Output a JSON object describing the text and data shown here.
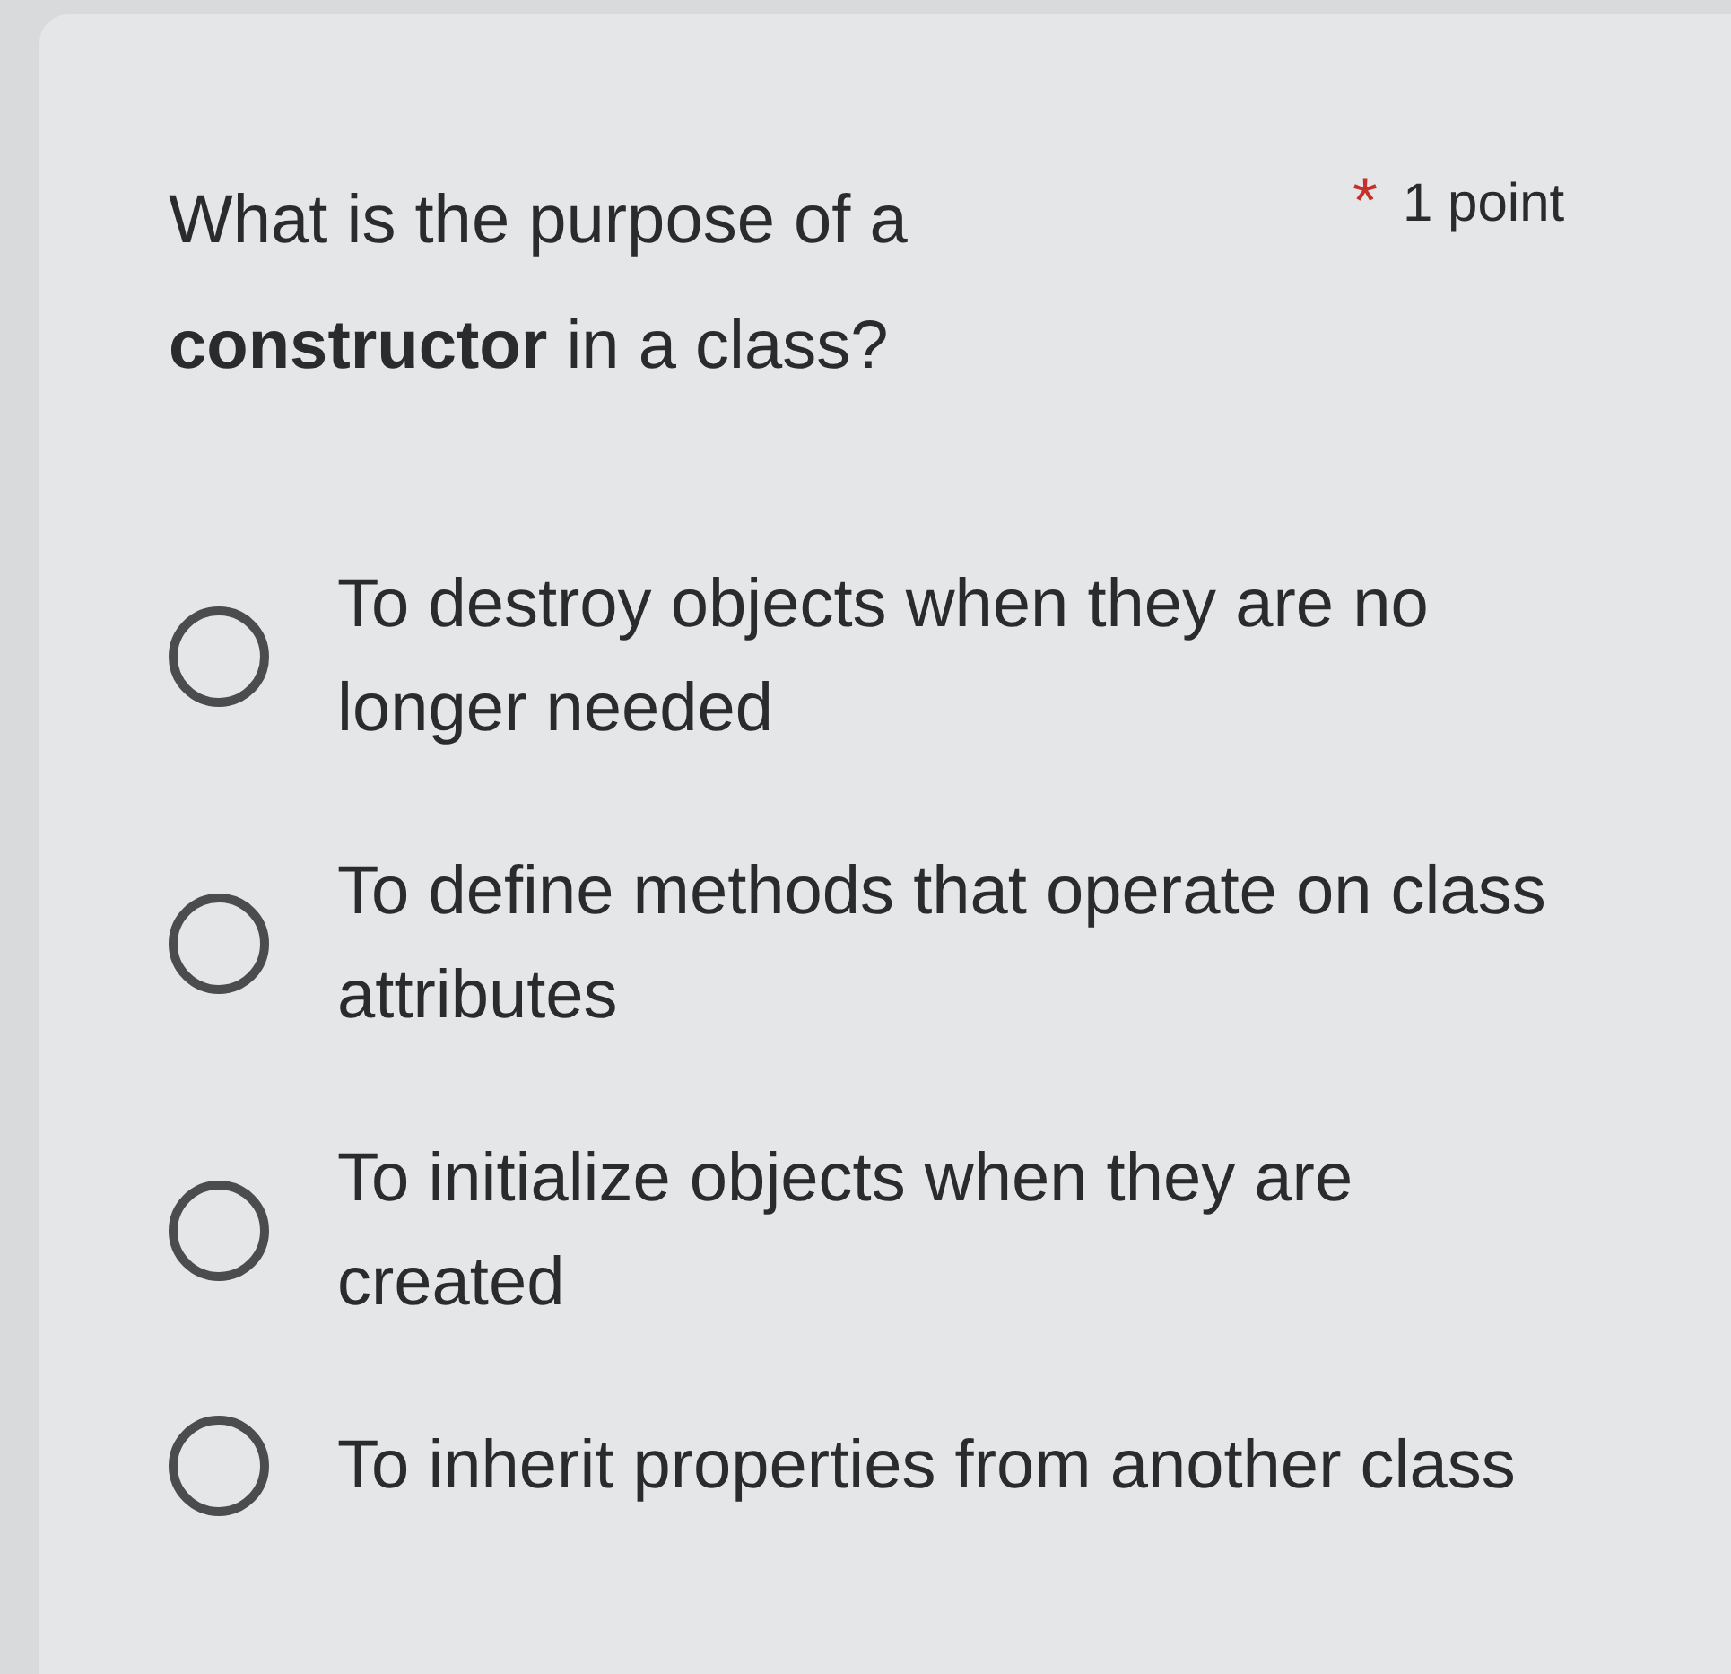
{
  "question": {
    "text": "What is the purpose of a **constructor** in a class?",
    "required_mark": "*",
    "points": "1 point"
  },
  "options": [
    {
      "label": "To destroy objects when they are no longer needed",
      "selected": false
    },
    {
      "label": "To define methods that operate on class attributes",
      "selected": false
    },
    {
      "label": "To initialize objects when they are created",
      "selected": false
    },
    {
      "label": "To inherit properties from another class",
      "selected": false
    }
  ]
}
